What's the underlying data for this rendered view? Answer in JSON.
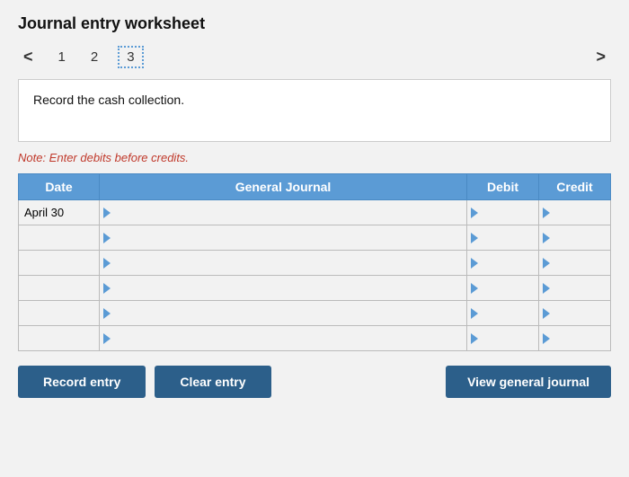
{
  "topBar": {
    "tabLabel": ""
  },
  "header": {
    "title": "Journal entry worksheet"
  },
  "pagination": {
    "prevArrow": "<",
    "nextArrow": ">",
    "pages": [
      "1",
      "2",
      "3"
    ],
    "activePage": 2
  },
  "instruction": {
    "text": "Record the cash collection."
  },
  "note": {
    "text": "Note: Enter debits before credits."
  },
  "table": {
    "columns": {
      "date": "Date",
      "generalJournal": "General Journal",
      "debit": "Debit",
      "credit": "Credit"
    },
    "rows": [
      {
        "date": "April 30",
        "gj": "",
        "debit": "",
        "credit": ""
      },
      {
        "date": "",
        "gj": "",
        "debit": "",
        "credit": ""
      },
      {
        "date": "",
        "gj": "",
        "debit": "",
        "credit": ""
      },
      {
        "date": "",
        "gj": "",
        "debit": "",
        "credit": ""
      },
      {
        "date": "",
        "gj": "",
        "debit": "",
        "credit": ""
      },
      {
        "date": "",
        "gj": "",
        "debit": "",
        "credit": ""
      }
    ]
  },
  "buttons": {
    "recordEntry": "Record entry",
    "clearEntry": "Clear entry",
    "viewGeneralJournal": "View general journal"
  }
}
